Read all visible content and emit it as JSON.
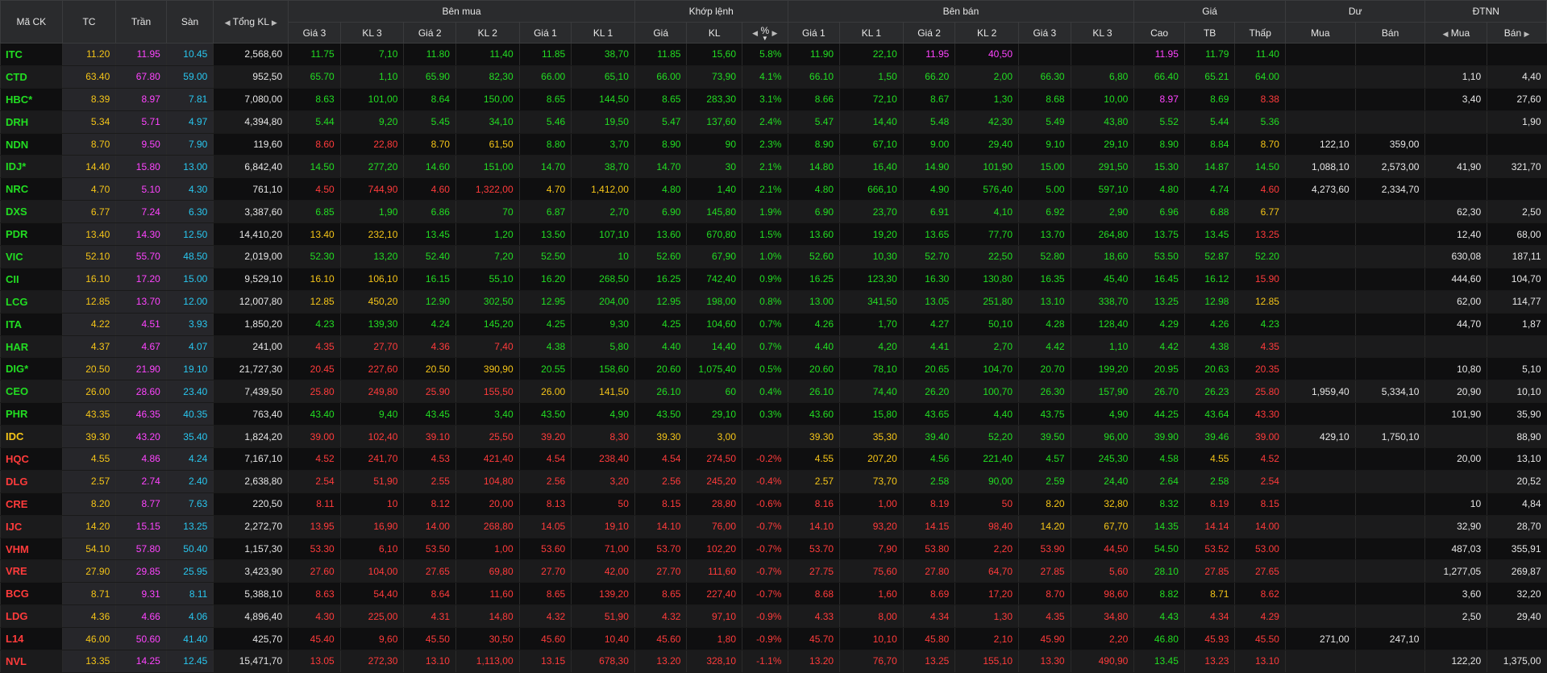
{
  "headers": {
    "ma_ck": "Mã CK",
    "tc": "TC",
    "tran": "Trần",
    "san": "Sàn",
    "tong_kl": "Tổng KL",
    "ben_mua": "Bên mua",
    "khop_lenh": "Khớp lệnh",
    "ben_ban": "Bên bán",
    "gia_group": "Giá",
    "du": "Dư",
    "dtnn": "ĐTNN",
    "gia3": "Giá 3",
    "kl3": "KL 3",
    "gia2": "Giá 2",
    "kl2": "KL 2",
    "gia1": "Giá 1",
    "kl1": "KL 1",
    "gia": "Giá",
    "kl": "KL",
    "pct": "%",
    "cao": "Cao",
    "tb": "TB",
    "thap": "Thấp",
    "mua": "Mua",
    "ban": "Bán"
  },
  "rows": [
    {
      "sym": "ITC",
      "ref": "11.20",
      "ce": "11.95",
      "fl": "10.45",
      "tot": "2,568,60",
      "b3": "11.75",
      "bv3": "7,10",
      "b2": "11.80",
      "bv2": "11,40",
      "b1": "11.85",
      "bv1": "38,70",
      "mp": "11.85",
      "mv": "15,60",
      "pct": "5.8%",
      "s1": "11.90",
      "sv1": "22,10",
      "s2": "11.95",
      "sv2": "40,50",
      "s3": "",
      "sv3": "",
      "hi": "11.95",
      "avg": "11.79",
      "lo": "11.40",
      "dm": "",
      "db": "",
      "fm": "",
      "fb": ""
    },
    {
      "sym": "CTD",
      "ref": "63.40",
      "ce": "67.80",
      "fl": "59.00",
      "tot": "952,50",
      "b3": "65.70",
      "bv3": "1,10",
      "b2": "65.90",
      "bv2": "82,30",
      "b1": "66.00",
      "bv1": "65,10",
      "mp": "66.00",
      "mv": "73,90",
      "pct": "4.1%",
      "s1": "66.10",
      "sv1": "1,50",
      "s2": "66.20",
      "sv2": "2,00",
      "s3": "66.30",
      "sv3": "6,80",
      "hi": "66.40",
      "avg": "65.21",
      "lo": "64.00",
      "dm": "",
      "db": "",
      "fm": "1,10",
      "fb": "4,40"
    },
    {
      "sym": "HBC*",
      "ref": "8.39",
      "ce": "8.97",
      "fl": "7.81",
      "tot": "7,080,00",
      "b3": "8.63",
      "bv3": "101,00",
      "b2": "8.64",
      "bv2": "150,00",
      "b1": "8.65",
      "bv1": "144,50",
      "mp": "8.65",
      "mv": "283,30",
      "pct": "3.1%",
      "s1": "8.66",
      "sv1": "72,10",
      "s2": "8.67",
      "sv2": "1,30",
      "s3": "8.68",
      "sv3": "10,00",
      "hi": "8.97",
      "avg": "8.69",
      "lo": "8.38",
      "dm": "",
      "db": "",
      "fm": "3,40",
      "fb": "27,60"
    },
    {
      "sym": "DRH",
      "ref": "5.34",
      "ce": "5.71",
      "fl": "4.97",
      "tot": "4,394,80",
      "b3": "5.44",
      "bv3": "9,20",
      "b2": "5.45",
      "bv2": "34,10",
      "b1": "5.46",
      "bv1": "19,50",
      "mp": "5.47",
      "mv": "137,60",
      "pct": "2.4%",
      "s1": "5.47",
      "sv1": "14,40",
      "s2": "5.48",
      "sv2": "42,30",
      "s3": "5.49",
      "sv3": "43,80",
      "hi": "5.52",
      "avg": "5.44",
      "lo": "5.36",
      "dm": "",
      "db": "",
      "fm": "",
      "fb": "1,90"
    },
    {
      "sym": "NDN",
      "ref": "8.70",
      "ce": "9.50",
      "fl": "7.90",
      "tot": "119,60",
      "b3": "8.60",
      "bv3": "22,80",
      "b2": "8.70",
      "bv2": "61,50",
      "b1": "8.80",
      "bv1": "3,70",
      "mp": "8.90",
      "mv": "90",
      "pct": "2.3%",
      "s1": "8.90",
      "sv1": "67,10",
      "s2": "9.00",
      "sv2": "29,40",
      "s3": "9.10",
      "sv3": "29,10",
      "hi": "8.90",
      "avg": "8.84",
      "lo": "8.70",
      "dm": "122,10",
      "db": "359,00",
      "fm": "",
      "fb": ""
    },
    {
      "sym": "IDJ*",
      "ref": "14.40",
      "ce": "15.80",
      "fl": "13.00",
      "tot": "6,842,40",
      "b3": "14.50",
      "bv3": "277,20",
      "b2": "14.60",
      "bv2": "151,00",
      "b1": "14.70",
      "bv1": "38,70",
      "mp": "14.70",
      "mv": "30",
      "pct": "2.1%",
      "s1": "14.80",
      "sv1": "16,40",
      "s2": "14.90",
      "sv2": "101,90",
      "s3": "15.00",
      "sv3": "291,50",
      "hi": "15.30",
      "avg": "14.87",
      "lo": "14.50",
      "dm": "1,088,10",
      "db": "2,573,00",
      "fm": "41,90",
      "fb": "321,70"
    },
    {
      "sym": "NRC",
      "ref": "4.70",
      "ce": "5.10",
      "fl": "4.30",
      "tot": "761,10",
      "b3": "4.50",
      "bv3": "744,90",
      "b2": "4.60",
      "bv2": "1,322,00",
      "b1": "4.70",
      "bv1": "1,412,00",
      "mp": "4.80",
      "mv": "1,40",
      "pct": "2.1%",
      "s1": "4.80",
      "sv1": "666,10",
      "s2": "4.90",
      "sv2": "576,40",
      "s3": "5.00",
      "sv3": "597,10",
      "hi": "4.80",
      "avg": "4.74",
      "lo": "4.60",
      "dm": "4,273,60",
      "db": "2,334,70",
      "fm": "",
      "fb": ""
    },
    {
      "sym": "DXS",
      "ref": "6.77",
      "ce": "7.24",
      "fl": "6.30",
      "tot": "3,387,60",
      "b3": "6.85",
      "bv3": "1,90",
      "b2": "6.86",
      "bv2": "70",
      "b1": "6.87",
      "bv1": "2,70",
      "mp": "6.90",
      "mv": "145,80",
      "pct": "1.9%",
      "s1": "6.90",
      "sv1": "23,70",
      "s2": "6.91",
      "sv2": "4,10",
      "s3": "6.92",
      "sv3": "2,90",
      "hi": "6.96",
      "avg": "6.88",
      "lo": "6.77",
      "dm": "",
      "db": "",
      "fm": "62,30",
      "fb": "2,50"
    },
    {
      "sym": "PDR",
      "ref": "13.40",
      "ce": "14.30",
      "fl": "12.50",
      "tot": "14,410,20",
      "b3": "13.40",
      "bv3": "232,10",
      "b2": "13.45",
      "bv2": "1,20",
      "b1": "13.50",
      "bv1": "107,10",
      "mp": "13.60",
      "mv": "670,80",
      "pct": "1.5%",
      "s1": "13.60",
      "sv1": "19,20",
      "s2": "13.65",
      "sv2": "77,70",
      "s3": "13.70",
      "sv3": "264,80",
      "hi": "13.75",
      "avg": "13.45",
      "lo": "13.25",
      "dm": "",
      "db": "",
      "fm": "12,40",
      "fb": "68,00"
    },
    {
      "sym": "VIC",
      "ref": "52.10",
      "ce": "55.70",
      "fl": "48.50",
      "tot": "2,019,00",
      "b3": "52.30",
      "bv3": "13,20",
      "b2": "52.40",
      "bv2": "7,20",
      "b1": "52.50",
      "bv1": "10",
      "mp": "52.60",
      "mv": "67,90",
      "pct": "1.0%",
      "s1": "52.60",
      "sv1": "10,30",
      "s2": "52.70",
      "sv2": "22,50",
      "s3": "52.80",
      "sv3": "18,60",
      "hi": "53.50",
      "avg": "52.87",
      "lo": "52.20",
      "dm": "",
      "db": "",
      "fm": "630,08",
      "fb": "187,11"
    },
    {
      "sym": "CII",
      "ref": "16.10",
      "ce": "17.20",
      "fl": "15.00",
      "tot": "9,529,10",
      "b3": "16.10",
      "bv3": "106,10",
      "b2": "16.15",
      "bv2": "55,10",
      "b1": "16.20",
      "bv1": "268,50",
      "mp": "16.25",
      "mv": "742,40",
      "pct": "0.9%",
      "s1": "16.25",
      "sv1": "123,30",
      "s2": "16.30",
      "sv2": "130,80",
      "s3": "16.35",
      "sv3": "45,40",
      "hi": "16.45",
      "avg": "16.12",
      "lo": "15.90",
      "dm": "",
      "db": "",
      "fm": "444,60",
      "fb": "104,70"
    },
    {
      "sym": "LCG",
      "ref": "12.85",
      "ce": "13.70",
      "fl": "12.00",
      "tot": "12,007,80",
      "b3": "12.85",
      "bv3": "450,20",
      "b2": "12.90",
      "bv2": "302,50",
      "b1": "12.95",
      "bv1": "204,00",
      "mp": "12.95",
      "mv": "198,00",
      "pct": "0.8%",
      "s1": "13.00",
      "sv1": "341,50",
      "s2": "13.05",
      "sv2": "251,80",
      "s3": "13.10",
      "sv3": "338,70",
      "hi": "13.25",
      "avg": "12.98",
      "lo": "12.85",
      "dm": "",
      "db": "",
      "fm": "62,00",
      "fb": "114,77"
    },
    {
      "sym": "ITA",
      "ref": "4.22",
      "ce": "4.51",
      "fl": "3.93",
      "tot": "1,850,20",
      "b3": "4.23",
      "bv3": "139,30",
      "b2": "4.24",
      "bv2": "145,20",
      "b1": "4.25",
      "bv1": "9,30",
      "mp": "4.25",
      "mv": "104,60",
      "pct": "0.7%",
      "s1": "4.26",
      "sv1": "1,70",
      "s2": "4.27",
      "sv2": "50,10",
      "s3": "4.28",
      "sv3": "128,40",
      "hi": "4.29",
      "avg": "4.26",
      "lo": "4.23",
      "dm": "",
      "db": "",
      "fm": "44,70",
      "fb": "1,87"
    },
    {
      "sym": "HAR",
      "ref": "4.37",
      "ce": "4.67",
      "fl": "4.07",
      "tot": "241,00",
      "b3": "4.35",
      "bv3": "27,70",
      "b2": "4.36",
      "bv2": "7,40",
      "b1": "4.38",
      "bv1": "5,80",
      "mp": "4.40",
      "mv": "14,40",
      "pct": "0.7%",
      "s1": "4.40",
      "sv1": "4,20",
      "s2": "4.41",
      "sv2": "2,70",
      "s3": "4.42",
      "sv3": "1,10",
      "hi": "4.42",
      "avg": "4.38",
      "lo": "4.35",
      "dm": "",
      "db": "",
      "fm": "",
      "fb": ""
    },
    {
      "sym": "DIG*",
      "ref": "20.50",
      "ce": "21.90",
      "fl": "19.10",
      "tot": "21,727,30",
      "b3": "20.45",
      "bv3": "227,60",
      "b2": "20.50",
      "bv2": "390,90",
      "b1": "20.55",
      "bv1": "158,60",
      "mp": "20.60",
      "mv": "1,075,40",
      "pct": "0.5%",
      "s1": "20.60",
      "sv1": "78,10",
      "s2": "20.65",
      "sv2": "104,70",
      "s3": "20.70",
      "sv3": "199,20",
      "hi": "20.95",
      "avg": "20.63",
      "lo": "20.35",
      "dm": "",
      "db": "",
      "fm": "10,80",
      "fb": "5,10"
    },
    {
      "sym": "CEO",
      "ref": "26.00",
      "ce": "28.60",
      "fl": "23.40",
      "tot": "7,439,50",
      "b3": "25.80",
      "bv3": "249,80",
      "b2": "25.90",
      "bv2": "155,50",
      "b1": "26.00",
      "bv1": "141,50",
      "mp": "26.10",
      "mv": "60",
      "pct": "0.4%",
      "s1": "26.10",
      "sv1": "74,40",
      "s2": "26.20",
      "sv2": "100,70",
      "s3": "26.30",
      "sv3": "157,90",
      "hi": "26.70",
      "avg": "26.23",
      "lo": "25.80",
      "dm": "1,959,40",
      "db": "5,334,10",
      "fm": "20,90",
      "fb": "10,10"
    },
    {
      "sym": "PHR",
      "ref": "43.35",
      "ce": "46.35",
      "fl": "40.35",
      "tot": "763,40",
      "b3": "43.40",
      "bv3": "9,40",
      "b2": "43.45",
      "bv2": "3,40",
      "b1": "43.50",
      "bv1": "4,90",
      "mp": "43.50",
      "mv": "29,10",
      "pct": "0.3%",
      "s1": "43.60",
      "sv1": "15,80",
      "s2": "43.65",
      "sv2": "4,40",
      "s3": "43.75",
      "sv3": "4,90",
      "hi": "44.25",
      "avg": "43.64",
      "lo": "43.30",
      "dm": "",
      "db": "",
      "fm": "101,90",
      "fb": "35,90"
    },
    {
      "sym": "IDC",
      "ref": "39.30",
      "ce": "43.20",
      "fl": "35.40",
      "tot": "1,824,20",
      "b3": "39.00",
      "bv3": "102,40",
      "b2": "39.10",
      "bv2": "25,50",
      "b1": "39.20",
      "bv1": "8,30",
      "mp": "39.30",
      "mv": "3,00",
      "pct": "",
      "s1": "39.30",
      "sv1": "35,30",
      "s2": "39.40",
      "sv2": "52,20",
      "s3": "39.50",
      "sv3": "96,00",
      "hi": "39.90",
      "avg": "39.46",
      "lo": "39.00",
      "dm": "429,10",
      "db": "1,750,10",
      "fm": "",
      "fb": "88,90"
    },
    {
      "sym": "HQC",
      "ref": "4.55",
      "ce": "4.86",
      "fl": "4.24",
      "tot": "7,167,10",
      "b3": "4.52",
      "bv3": "241,70",
      "b2": "4.53",
      "bv2": "421,40",
      "b1": "4.54",
      "bv1": "238,40",
      "mp": "4.54",
      "mv": "274,50",
      "pct": "-0.2%",
      "s1": "4.55",
      "sv1": "207,20",
      "s2": "4.56",
      "sv2": "221,40",
      "s3": "4.57",
      "sv3": "245,30",
      "hi": "4.58",
      "avg": "4.55",
      "lo": "4.52",
      "dm": "",
      "db": "",
      "fm": "20,00",
      "fb": "13,10"
    },
    {
      "sym": "DLG",
      "ref": "2.57",
      "ce": "2.74",
      "fl": "2.40",
      "tot": "2,638,80",
      "b3": "2.54",
      "bv3": "51,90",
      "b2": "2.55",
      "bv2": "104,80",
      "b1": "2.56",
      "bv1": "3,20",
      "mp": "2.56",
      "mv": "245,20",
      "pct": "-0.4%",
      "s1": "2.57",
      "sv1": "73,70",
      "s2": "2.58",
      "sv2": "90,00",
      "s3": "2.59",
      "sv3": "24,40",
      "hi": "2.64",
      "avg": "2.58",
      "lo": "2.54",
      "dm": "",
      "db": "",
      "fm": "",
      "fb": "20,52"
    },
    {
      "sym": "CRE",
      "ref": "8.20",
      "ce": "8.77",
      "fl": "7.63",
      "tot": "220,50",
      "b3": "8.11",
      "bv3": "10",
      "b2": "8.12",
      "bv2": "20,00",
      "b1": "8.13",
      "bv1": "50",
      "mp": "8.15",
      "mv": "28,80",
      "pct": "-0.6%",
      "s1": "8.16",
      "sv1": "1,00",
      "s2": "8.19",
      "sv2": "50",
      "s3": "8.20",
      "sv3": "32,80",
      "hi": "8.32",
      "avg": "8.19",
      "lo": "8.15",
      "dm": "",
      "db": "",
      "fm": "10",
      "fb": "4,84"
    },
    {
      "sym": "IJC",
      "ref": "14.20",
      "ce": "15.15",
      "fl": "13.25",
      "tot": "2,272,70",
      "b3": "13.95",
      "bv3": "16,90",
      "b2": "14.00",
      "bv2": "268,80",
      "b1": "14.05",
      "bv1": "19,10",
      "mp": "14.10",
      "mv": "76,00",
      "pct": "-0.7%",
      "s1": "14.10",
      "sv1": "93,20",
      "s2": "14.15",
      "sv2": "98,40",
      "s3": "14.20",
      "sv3": "67,70",
      "hi": "14.35",
      "avg": "14.14",
      "lo": "14.00",
      "dm": "",
      "db": "",
      "fm": "32,90",
      "fb": "28,70"
    },
    {
      "sym": "VHM",
      "ref": "54.10",
      "ce": "57.80",
      "fl": "50.40",
      "tot": "1,157,30",
      "b3": "53.30",
      "bv3": "6,10",
      "b2": "53.50",
      "bv2": "1,00",
      "b1": "53.60",
      "bv1": "71,00",
      "mp": "53.70",
      "mv": "102,20",
      "pct": "-0.7%",
      "s1": "53.70",
      "sv1": "7,90",
      "s2": "53.80",
      "sv2": "2,20",
      "s3": "53.90",
      "sv3": "44,50",
      "hi": "54.50",
      "avg": "53.52",
      "lo": "53.00",
      "dm": "",
      "db": "",
      "fm": "487,03",
      "fb": "355,91"
    },
    {
      "sym": "VRE",
      "ref": "27.90",
      "ce": "29.85",
      "fl": "25.95",
      "tot": "3,423,90",
      "b3": "27.60",
      "bv3": "104,00",
      "b2": "27.65",
      "bv2": "69,80",
      "b1": "27.70",
      "bv1": "42,00",
      "mp": "27.70",
      "mv": "111,60",
      "pct": "-0.7%",
      "s1": "27.75",
      "sv1": "75,60",
      "s2": "27.80",
      "sv2": "64,70",
      "s3": "27.85",
      "sv3": "5,60",
      "hi": "28.10",
      "avg": "27.85",
      "lo": "27.65",
      "dm": "",
      "db": "",
      "fm": "1,277,05",
      "fb": "269,87"
    },
    {
      "sym": "BCG",
      "ref": "8.71",
      "ce": "9.31",
      "fl": "8.11",
      "tot": "5,388,10",
      "b3": "8.63",
      "bv3": "54,40",
      "b2": "8.64",
      "bv2": "11,60",
      "b1": "8.65",
      "bv1": "139,20",
      "mp": "8.65",
      "mv": "227,40",
      "pct": "-0.7%",
      "s1": "8.68",
      "sv1": "1,60",
      "s2": "8.69",
      "sv2": "17,20",
      "s3": "8.70",
      "sv3": "98,60",
      "hi": "8.82",
      "avg": "8.71",
      "lo": "8.62",
      "dm": "",
      "db": "",
      "fm": "3,60",
      "fb": "32,20"
    },
    {
      "sym": "LDG",
      "ref": "4.36",
      "ce": "4.66",
      "fl": "4.06",
      "tot": "4,896,40",
      "b3": "4.30",
      "bv3": "225,00",
      "b2": "4.31",
      "bv2": "14,80",
      "b1": "4.32",
      "bv1": "51,90",
      "mp": "4.32",
      "mv": "97,10",
      "pct": "-0.9%",
      "s1": "4.33",
      "sv1": "8,00",
      "s2": "4.34",
      "sv2": "1,30",
      "s3": "4.35",
      "sv3": "34,80",
      "hi": "4.43",
      "avg": "4.34",
      "lo": "4.29",
      "dm": "",
      "db": "",
      "fm": "2,50",
      "fb": "29,40"
    },
    {
      "sym": "L14",
      "ref": "46.00",
      "ce": "50.60",
      "fl": "41.40",
      "tot": "425,70",
      "b3": "45.40",
      "bv3": "9,60",
      "b2": "45.50",
      "bv2": "30,50",
      "b1": "45.60",
      "bv1": "10,40",
      "mp": "45.60",
      "mv": "1,80",
      "pct": "-0.9%",
      "s1": "45.70",
      "sv1": "10,10",
      "s2": "45.80",
      "sv2": "2,10",
      "s3": "45.90",
      "sv3": "2,20",
      "hi": "46.80",
      "avg": "45.93",
      "lo": "45.50",
      "dm": "271,00",
      "db": "247,10",
      "fm": "",
      "fb": ""
    },
    {
      "sym": "NVL",
      "ref": "13.35",
      "ce": "14.25",
      "fl": "12.45",
      "tot": "15,471,70",
      "b3": "13.05",
      "bv3": "272,30",
      "b2": "13.10",
      "bv2": "1,113,00",
      "b1": "13.15",
      "bv1": "678,30",
      "mp": "13.20",
      "mv": "328,10",
      "pct": "-1.1%",
      "s1": "13.20",
      "sv1": "76,70",
      "s2": "13.25",
      "sv2": "155,10",
      "s3": "13.30",
      "sv3": "490,90",
      "hi": "13.45",
      "avg": "13.23",
      "lo": "13.10",
      "dm": "",
      "db": "",
      "fm": "122,20",
      "fb": "1,375,00"
    }
  ]
}
